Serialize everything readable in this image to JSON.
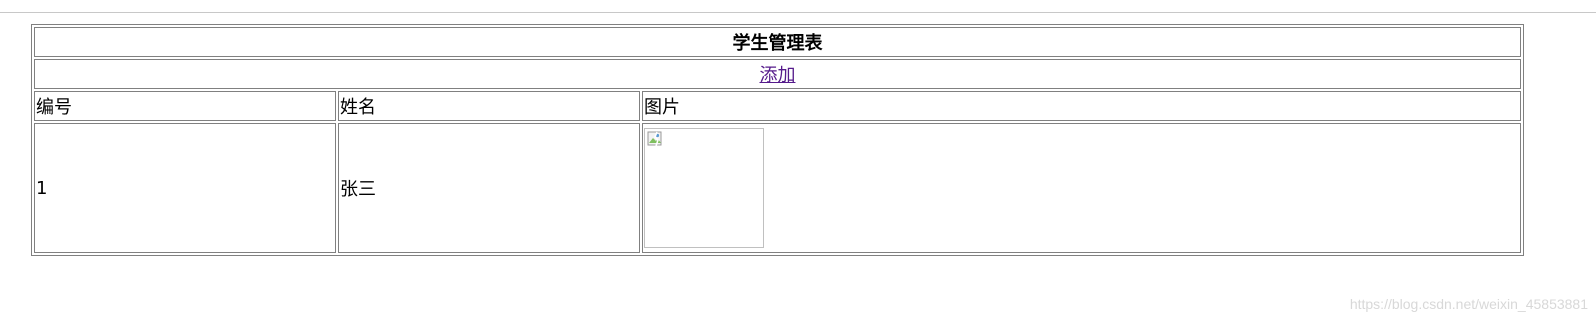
{
  "table": {
    "title": "学生管理表",
    "add_link": "添加",
    "headers": [
      "编号",
      "姓名",
      "图片"
    ],
    "rows": [
      {
        "id": "1",
        "name": "张三",
        "image": "broken-image-icon"
      }
    ]
  },
  "watermark": "https://blog.csdn.net/weixin_45853881",
  "colors": {
    "border": "#808080",
    "link": "#551a8b"
  }
}
